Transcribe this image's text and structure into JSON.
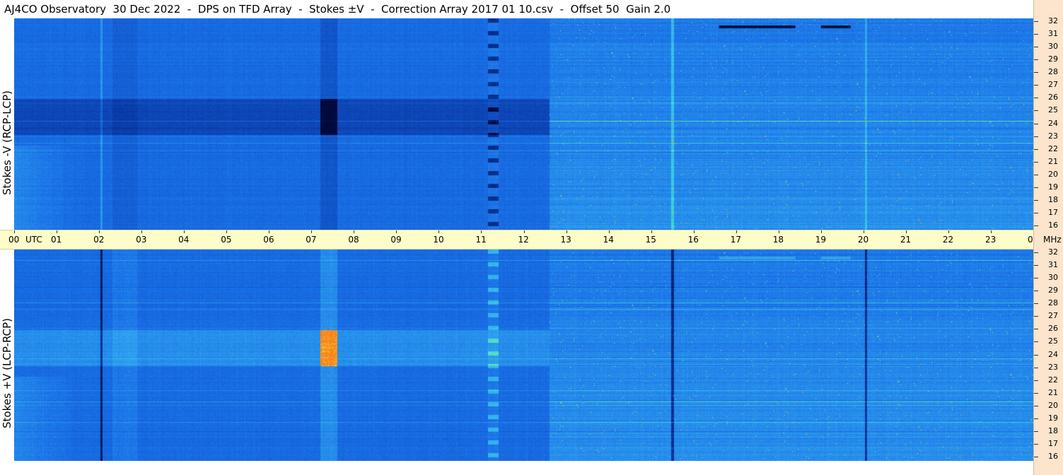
{
  "title": "AJ4CO Observatory  30 Dec 2022  -  DPS on TFD Array  -  Stokes ±V  -  Correction Array 2017 01 10.csv  -  Offset 50  Gain 2.0",
  "chart_data": {
    "type": "heatmap",
    "panels": [
      {
        "label": "Stokes -V (RCP-LCP)",
        "tone": "darker-blue"
      },
      {
        "label": "Stokes +V (LCP-RCP)",
        "tone": "lighter-blue"
      }
    ],
    "time_ticks": [
      "00",
      "01",
      "02",
      "03",
      "04",
      "05",
      "06",
      "07",
      "08",
      "09",
      "10",
      "11",
      "12",
      "13",
      "14",
      "15",
      "16",
      "17",
      "18",
      "19",
      "20",
      "21",
      "22",
      "23",
      "00"
    ],
    "time_unit": "UTC",
    "freq_ticks": [
      32,
      31,
      30,
      29,
      28,
      27,
      26,
      25,
      24,
      23,
      22,
      21,
      20,
      19,
      18,
      17,
      16
    ],
    "freq_unit": "MHz",
    "colors": {
      "low": "#00184a",
      "mid": "#1e6ee6",
      "high": "#3fd2e6",
      "peak": "#f0e030"
    }
  }
}
